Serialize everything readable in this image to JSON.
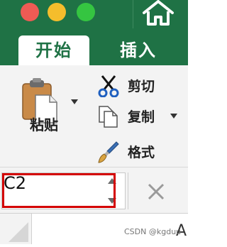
{
  "window": {
    "controls": [
      "close",
      "minimize",
      "maximize"
    ],
    "home_icon": "house-icon"
  },
  "ribbon_tabs": [
    {
      "label": "开始",
      "active": true
    },
    {
      "label": "插入",
      "active": false
    }
  ],
  "clipboard": {
    "paste_label": "粘贴",
    "paste_icon": "clipboard-icon",
    "cut_label": "剪切",
    "cut_icon": "scissors-icon",
    "copy_label": "复制",
    "copy_icon": "copy-icon",
    "format_label": "格式",
    "format_icon": "paintbrush-icon"
  },
  "formula_bar": {
    "name_box_value": "C2",
    "cancel_icon": "x-icon"
  },
  "grid": {
    "visible_column_header": "A"
  },
  "watermark": "CSDN @kgduu",
  "colors": {
    "accent": "#1f7245",
    "highlight": "#d40000"
  }
}
